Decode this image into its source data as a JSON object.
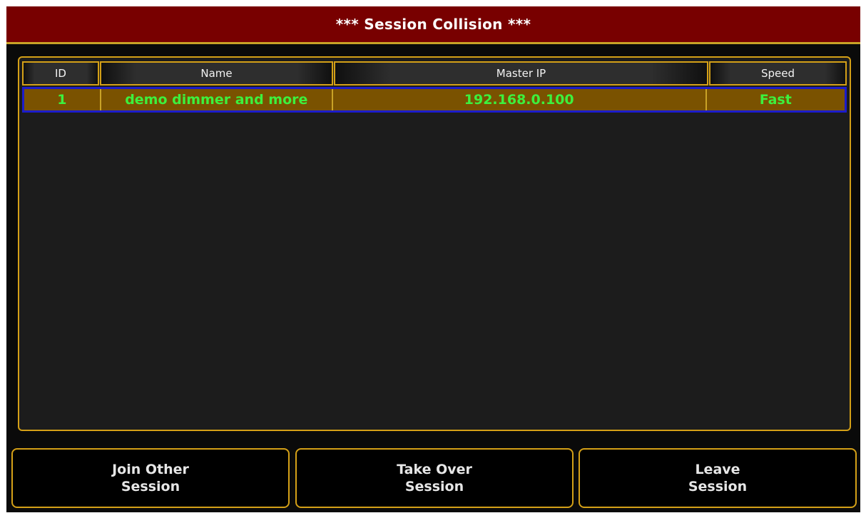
{
  "dialog": {
    "title": "***  Session Collision ***"
  },
  "table": {
    "columns": [
      "ID",
      "Name",
      "Master IP",
      "Speed"
    ],
    "rows": [
      {
        "id": "1",
        "name": "demo dimmer and more",
        "master_ip": "192.168.0.100",
        "speed": "Fast",
        "selected": true
      }
    ]
  },
  "buttons": {
    "join_line1": "Join Other",
    "join_line2": "Session",
    "take_line1": "Take Over",
    "take_line2": "Session",
    "leave_line1": "Leave",
    "leave_line2": "Session"
  },
  "colors": {
    "title_bar": "#780000",
    "accent_border": "#d4a017",
    "selected_row_bg": "#7a5200",
    "selected_row_border": "#1c1ccc",
    "selected_row_text": "#3df03d"
  }
}
